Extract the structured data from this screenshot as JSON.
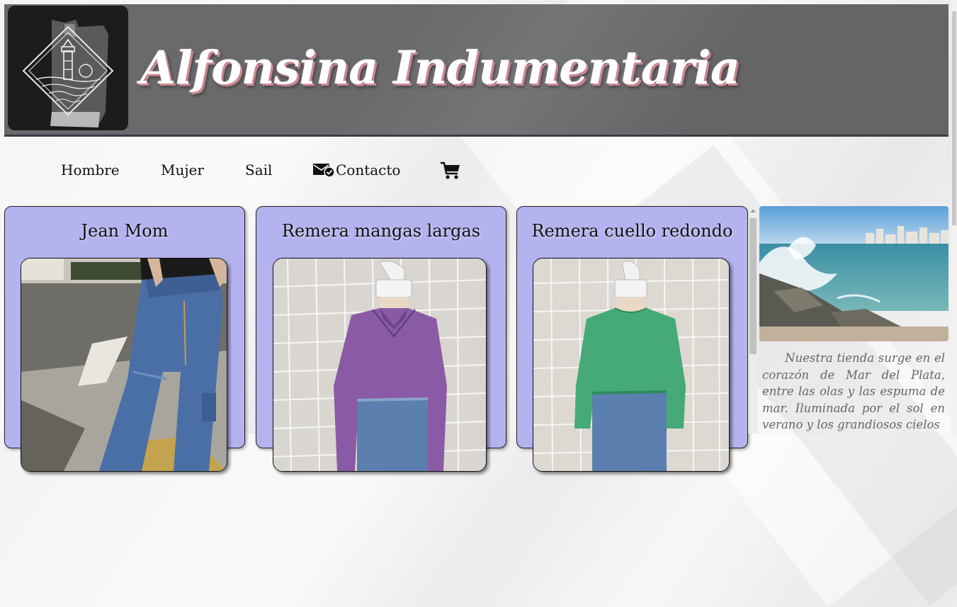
{
  "header": {
    "site_title": "Alfonsina Indumentaria",
    "logo_icon": "lighthouse-logo"
  },
  "nav": {
    "items": [
      {
        "label": "Hombre"
      },
      {
        "label": "Mujer"
      },
      {
        "label": "Sail"
      },
      {
        "label": "Contacto",
        "icon": "envelope-check-icon"
      }
    ],
    "cart_icon": "shopping-cart-icon"
  },
  "products": [
    {
      "title": "Jean Mom",
      "image": "denim-jeans-photo"
    },
    {
      "title": "Remera mangas largas",
      "image": "purple-long-sleeve-shirt-photo"
    },
    {
      "title": "Remera cuello redondo",
      "image": "green-round-neck-shirt-photo"
    }
  ],
  "sidebar": {
    "image": "mar-del-plata-coast-photo",
    "text": "Nuestra tienda surge en el corazón de Mar del Plata, entre las olas y las espuma de mar. Iluminada por el sol en verano y los grandiosos cielos"
  },
  "colors": {
    "header_bg": "#6a6a6c",
    "card_bg": "#b5b3ef",
    "title_shadow": "#c9868f"
  }
}
